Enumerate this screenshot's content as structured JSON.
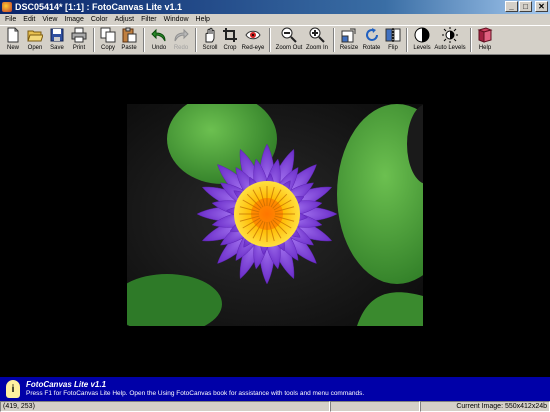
{
  "window": {
    "title": "DSC05414* [1:1] : FotoCanvas Lite v1.1",
    "controls": {
      "minimize": "_",
      "maximize": "□",
      "close": "✕"
    }
  },
  "menu": [
    "File",
    "Edit",
    "View",
    "Image",
    "Color",
    "Adjust",
    "Filter",
    "Window",
    "Help"
  ],
  "toolbar": {
    "new": "New",
    "open": "Open",
    "save": "Save",
    "print": "Print",
    "copy": "Copy",
    "paste": "Paste",
    "undo": "Undo",
    "redo": "Redo",
    "scroll": "Scroll",
    "crop": "Crop",
    "redeye": "Red-eye",
    "zoomout": "Zoom Out",
    "zoomin": "Zoom In",
    "resize": "Resize",
    "rotate": "Rotate",
    "flip": "Flip",
    "levels": "Levels",
    "autolevels": "Auto Levels",
    "help": "Help"
  },
  "helpbar": {
    "title": "FotoCanvas Lite v1.1",
    "text": "Press F1 for FotoCanvas Lite Help.  Open the Using FotoCanvas book for assistance with tools and menu commands."
  },
  "status": {
    "coords": "(419, 253)",
    "current_image": "Current Image: 550x412x24b"
  },
  "colors": {
    "title_bar_start": "#0a246a",
    "help_bar": "#0000a8",
    "canvas": "#000000",
    "chrome": "#d4d0c8"
  }
}
